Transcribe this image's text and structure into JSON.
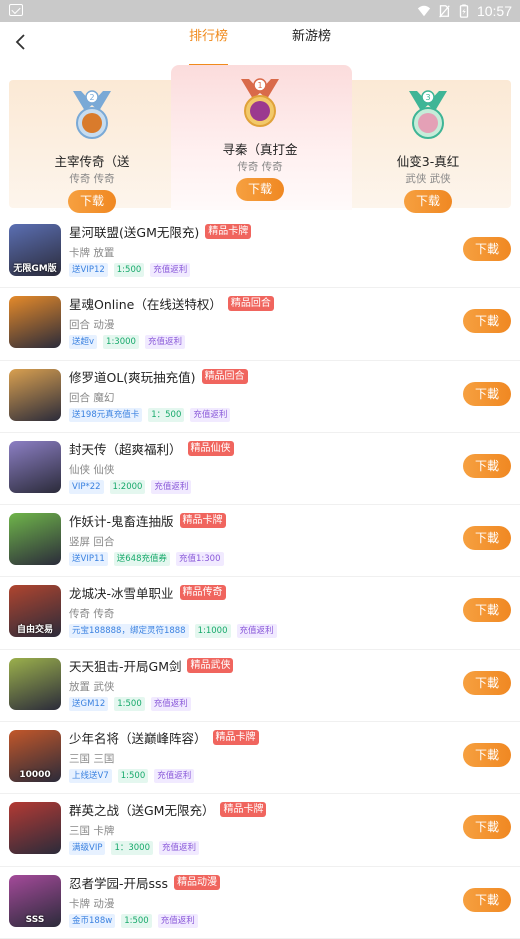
{
  "statusbar": {
    "time": "10:57"
  },
  "nav": {
    "tabs": [
      "排行榜",
      "新游榜"
    ]
  },
  "podium": [
    {
      "rank": "2",
      "name": "主宰传奇（送",
      "tags": "传奇 传奇",
      "download": "下载",
      "color": "#7aa9d6"
    },
    {
      "rank": "1",
      "name": "寻秦（真打金",
      "tags": "传奇 传奇",
      "download": "下载",
      "color": "#e0a23a"
    },
    {
      "rank": "3",
      "name": "仙变3-真红",
      "tags": "武侠 武侠",
      "download": "下载",
      "color": "#3fb596"
    }
  ],
  "games": [
    {
      "title": "星河联盟(送GM无限充)",
      "badge": "精品卡牌",
      "sub": "卡牌 放置",
      "chips": [
        "送VIP12",
        "1:500",
        "充值返利"
      ],
      "download": "下載",
      "icon_text": "无限GM版",
      "icon_color": "#5b6fb3"
    },
    {
      "title": "星魂Online（在线送特权）",
      "badge": "精品回合",
      "sub": "回合 动漫",
      "chips": [
        "送超v",
        "1:3000",
        "充值返利"
      ],
      "download": "下載",
      "icon_text": "",
      "icon_color": "#e58a2a"
    },
    {
      "title": "修罗道OL(爽玩抽充值)",
      "badge": "精品回合",
      "sub": "回合 魔幻",
      "chips": [
        "送198元真充值卡",
        "1：500",
        "充值返利"
      ],
      "download": "下載",
      "icon_text": "",
      "icon_color": "#d9a050"
    },
    {
      "title": "封天传（超爽福利）",
      "badge": "精品仙侠",
      "sub": "仙侠 仙侠",
      "chips": [
        "VIP*22",
        "1:2000",
        "充值返利"
      ],
      "download": "下載",
      "icon_text": "",
      "icon_color": "#8c7fc4"
    },
    {
      "title": "作妖计-鬼畜连抽版",
      "badge": "精品卡牌",
      "sub": "竖屏 回合",
      "chips": [
        "送VIP11",
        "送648充值券",
        "充值1:300"
      ],
      "download": "下載",
      "icon_text": "",
      "icon_color": "#6fb54a"
    },
    {
      "title": "龙城决-冰雪单职业",
      "badge": "精品传奇",
      "sub": "传奇 传奇",
      "chips": [
        "元宝188888，绑定灵符1888",
        "1:1000",
        "充值返利"
      ],
      "download": "下載",
      "icon_text": "自由交易",
      "icon_color": "#b0452f"
    },
    {
      "title": "天天狙击-开局GM剑",
      "badge": "精品武侠",
      "sub": "放置 武侠",
      "chips": [
        "送GM12",
        "1:500",
        "充值返利"
      ],
      "download": "下載",
      "icon_text": "",
      "icon_color": "#9bb04c"
    },
    {
      "title": "少年名将（送巅峰阵容）",
      "badge": "精品卡牌",
      "sub": "三国 三国",
      "chips": [
        "上线送V7",
        "1:500",
        "充值返利"
      ],
      "download": "下載",
      "icon_text": "10000",
      "icon_color": "#c2572a"
    },
    {
      "title": "群英之战（送GM无限充）",
      "badge": "精品卡牌",
      "sub": "三国 卡牌",
      "chips": [
        "满级VIP",
        "1：3000",
        "充值返利"
      ],
      "download": "下載",
      "icon_text": "",
      "icon_color": "#b33a34"
    },
    {
      "title": "忍者学园-开局sss",
      "badge": "精品动漫",
      "sub": "卡牌 动漫",
      "chips": [
        "金币188w",
        "1:500",
        "充值返利"
      ],
      "download": "下載",
      "icon_text": "SSS",
      "icon_color": "#a44a9a"
    }
  ]
}
